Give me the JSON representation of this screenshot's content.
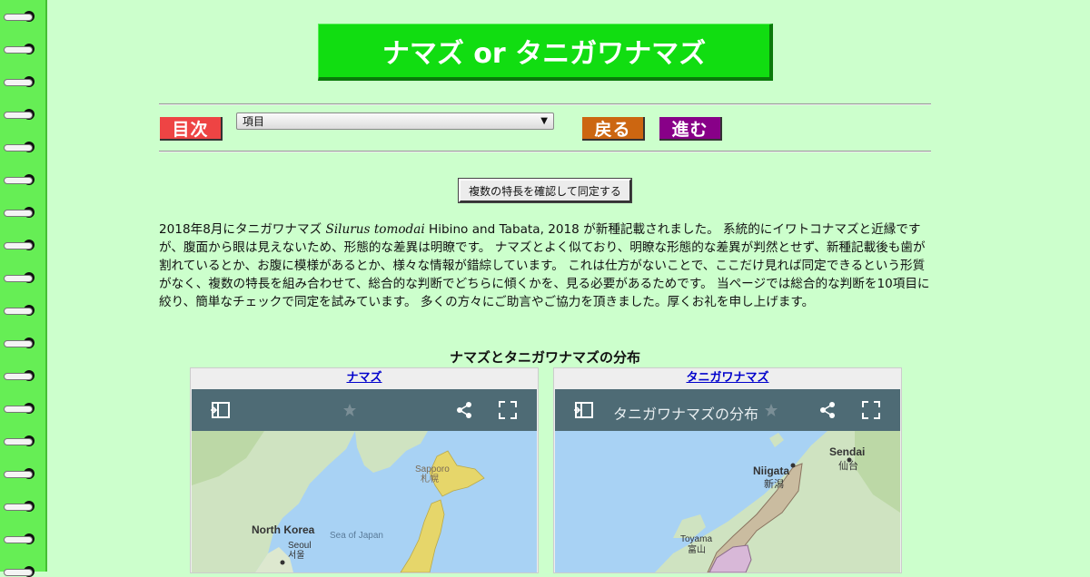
{
  "title": "ナマズ or タニガワナマズ",
  "nav": {
    "toc_label": "目次",
    "select_value": "項目",
    "back_label": "戻る",
    "next_label": "進む"
  },
  "check_button_label": "複数の特長を確認して同定する",
  "intro": {
    "part1": "2018年8月にタニガワナマズ ",
    "scientific_name": "Silurus tomodai",
    "part2": " Hibino and Tabata, 2018 が新種記載されました。 系統的にイワトコナマズと近縁ですが、腹面から眼は見えないため、形態的な差異は明瞭です。 ナマズとよく似ており、明瞭な形態的な差異が判然とせず、新種記載後も歯が割れているとか、お腹に模様があるとか、様々な情報が錯綜しています。 これは仕方がないことで、ここだけ見れば同定できるという形質がなく、複数の特長を組み合わせて、総合的な判断でどちらに傾くかを、見る必要があるためです。 当ページでは総合的な判断を10項目に絞り、簡単なチェックで同定を試みています。 多くの方々にご助言やご協力を頂きました。厚くお礼を申し上げます。"
  },
  "distribution": {
    "title": "ナマズとタニガワナマズの分布",
    "maps": [
      {
        "link_label": "ナマズ",
        "map_name": "",
        "labels": {
          "sapporo": "Sapporo",
          "sapporo_ja": "札幌",
          "north_korea": "North Korea",
          "sea_of_japan": "Sea of Japan",
          "seoul": "Seoul",
          "seoul_ko": "서울"
        }
      },
      {
        "link_label": "タニガワナマズ",
        "map_name": "タニガワナマズの分布",
        "labels": {
          "sendai": "Sendai",
          "sendai_ja": "仙台",
          "niigata": "Niigata",
          "niigata_ja": "新潟",
          "toyama": "Toyama",
          "toyama_ja": "富山"
        }
      }
    ]
  },
  "icons": {
    "sidebar_toggle": "sidebar-toggle-icon",
    "star": "star-icon",
    "share": "share-icon",
    "fullscreen": "fullscreen-icon"
  },
  "colors": {
    "background": "#ccffcc",
    "binding": "#66ee55",
    "title_bg": "#11dd11",
    "toc_button": "#ee4444",
    "back_button": "#cc6611",
    "next_button": "#880088",
    "map_header": "#4e6b75",
    "water": "#a8d2f4",
    "range_fill": "#e6d66a"
  }
}
